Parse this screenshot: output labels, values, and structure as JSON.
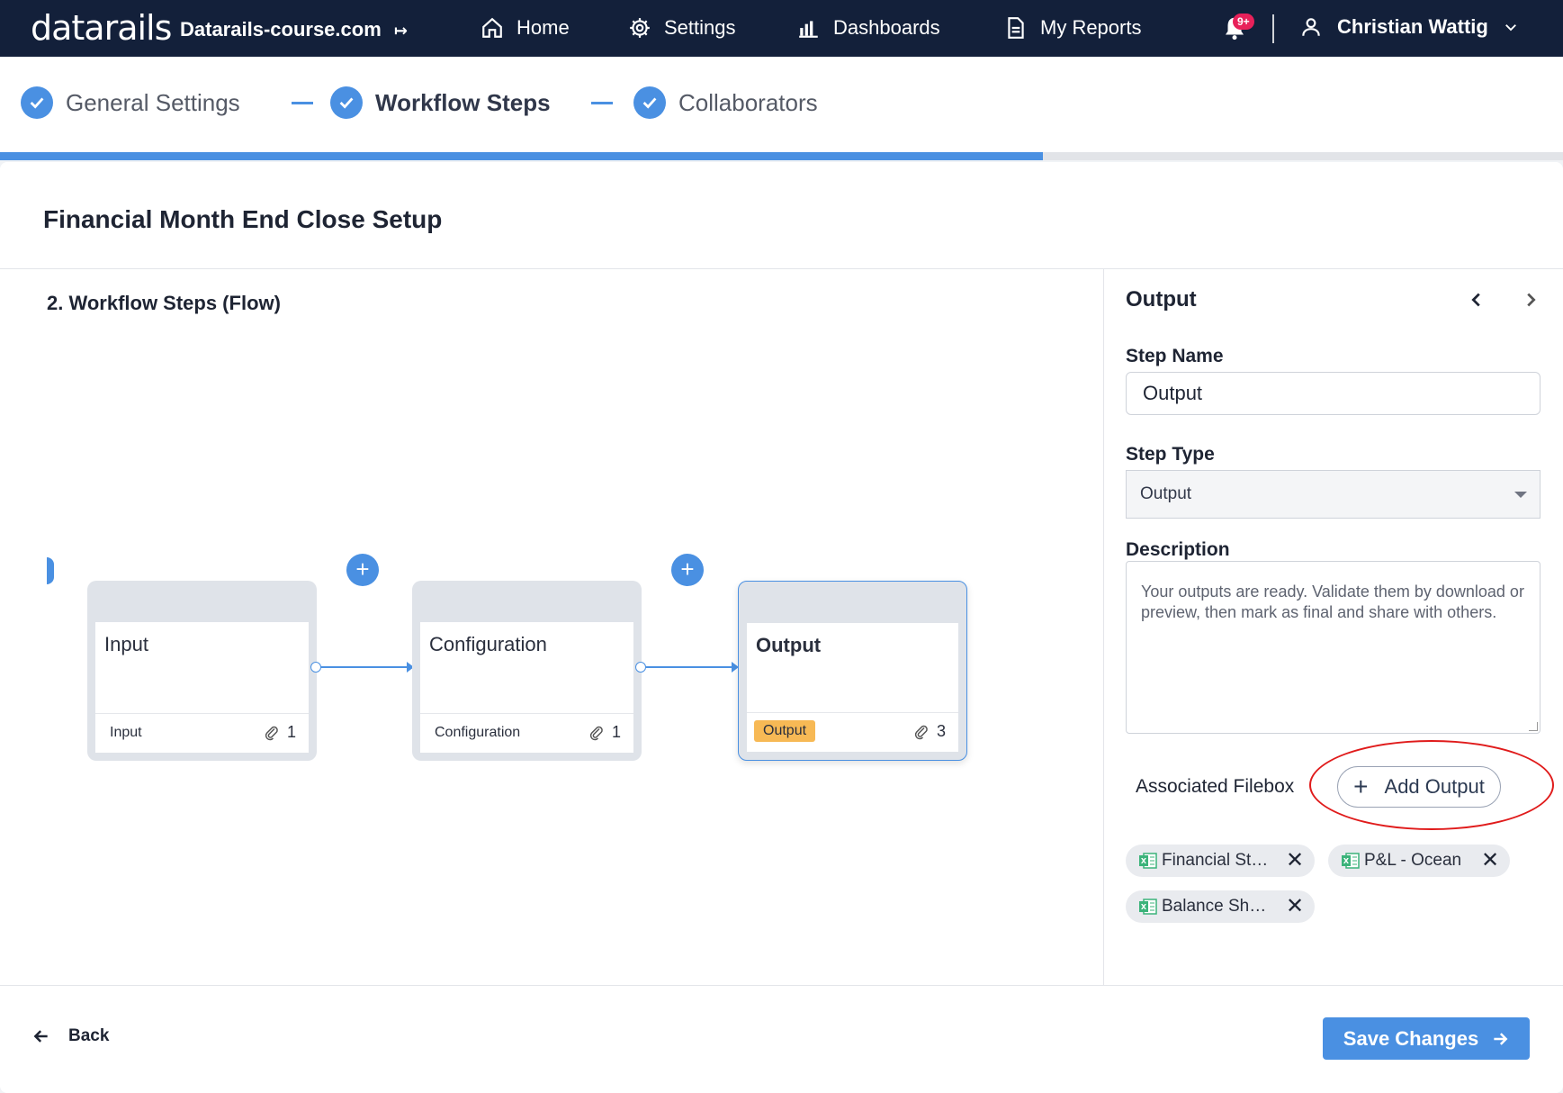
{
  "topbar": {
    "logo": "datarails",
    "domain": "Datarails-course.com",
    "nav": [
      {
        "label": "Home",
        "icon": "home-icon"
      },
      {
        "label": "Settings",
        "icon": "gear-icon"
      },
      {
        "label": "Dashboards",
        "icon": "bar-chart-icon"
      },
      {
        "label": "My Reports",
        "icon": "document-icon"
      }
    ],
    "notification_badge": "9+",
    "user_name": "Christian Wattig"
  },
  "stepper": {
    "steps": [
      {
        "label": "General Settings",
        "status": "done"
      },
      {
        "label": "Workflow Steps",
        "status": "current"
      },
      {
        "label": "Collaborators",
        "status": "done"
      }
    ],
    "progress_fraction": 0.667
  },
  "page": {
    "title": "Financial Month End Close Setup",
    "section_title": "2. Workflow Steps (Flow)"
  },
  "flow": {
    "nodes": [
      {
        "title": "Input",
        "type": "Input",
        "attachments": "1",
        "selected": false
      },
      {
        "title": "Configuration",
        "type": "Configuration",
        "attachments": "1",
        "selected": false
      },
      {
        "title": "Output",
        "type": "Output",
        "attachments": "3",
        "selected": true
      }
    ],
    "add_symbol": "+"
  },
  "panel": {
    "title": "Output",
    "prev_symbol": "‹",
    "next_symbol": "›",
    "step_name_label": "Step Name",
    "step_name_value": "Output",
    "step_type_label": "Step Type",
    "step_type_value": "Output",
    "description_label": "Description",
    "description_value": "Your outputs are ready. Validate them by download or preview, then mark as final and share with others.",
    "filebox_label": "Associated Filebox",
    "add_output_label": "Add Output",
    "files": [
      {
        "name": "Financial Statements"
      },
      {
        "name": "P&L - Ocean"
      },
      {
        "name": "Balance Sheet"
      }
    ]
  },
  "footer": {
    "back_label": "Back",
    "save_label": "Save Changes"
  },
  "colors": {
    "nav_bg": "#13203a",
    "accent": "#4a90e2",
    "output_tag": "#f7b955",
    "callout": "#e01b1b"
  }
}
